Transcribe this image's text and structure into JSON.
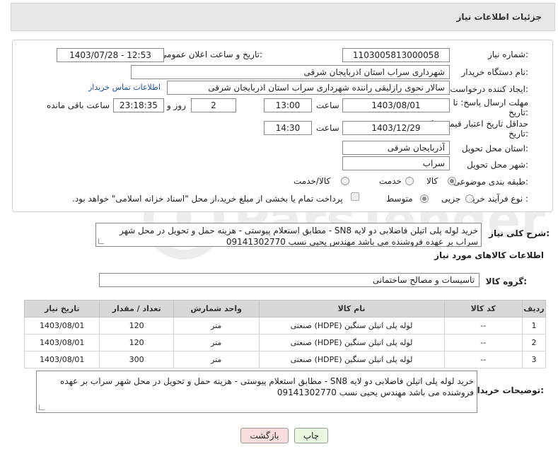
{
  "header": {
    "title": "جزئیات اطلاعات نیاز"
  },
  "fields": {
    "need_number_label": "شماره نیاز:",
    "need_number": "1103005813000058",
    "announce_label": "تاریخ و ساعت اعلان عمومی:",
    "announce_value": "1403/07/28 - 12:53",
    "buyer_org_label": "نام دستگاه خریدار:",
    "buyer_org": "شهرداری سراب استان اذربایجان شرقی",
    "requester_label": "ایجاد کننده درخواست:",
    "requester": "سالار نحوی رازلیقی راننده شهرداری سراب استان اذربایجان شرقی",
    "contact_link": "اطلاعات تماس خریدار",
    "deadline_label": "مهلت ارسال پاسخ: تا",
    "deadline_label2": "تاریخ:",
    "deadline_date": "1403/08/01",
    "time_label": "ساعت",
    "deadline_time": "13:00",
    "days_value": "2",
    "days_label": "روز و",
    "remaining_time": "23:18:35",
    "remaining_label": "ساعت باقی مانده",
    "validity_label": "حداقل تاریخ اعتبار قیمت: تا",
    "validity_label2": "تاریخ:",
    "validity_date": "1403/12/29",
    "validity_time": "14:30",
    "province_label": "استان محل تحویل:",
    "province": "آذربایجان شرقی",
    "city_label": "شهر محل تحویل:",
    "city": "سراب",
    "category_label": "طبقه بندی موضوعی:",
    "category_options": [
      "کالا",
      "خدمت",
      "کالا/خدمت"
    ],
    "process_label": "نوع فرآیند خرید :",
    "process_options": [
      "جزیی",
      "متوسط"
    ],
    "payment_note": "پرداخت تمام یا بخشی از مبلغ خرید،از محل \"اسناد خزانه اسلامی\" خواهد بود."
  },
  "summary": {
    "label": "شرح کلی نیاز:",
    "text": "خرید لوله پلی اتیلن فاضلابی دو لایه SN8 - مطابق استعلام پیوستی - هزینه حمل و تحویل در محل شهر سراب بر عهده فروشنده می باشد مهندس یحیی نسب 09141302770"
  },
  "goods": {
    "section_title": "اطلاعات کالاهای مورد نیاز",
    "group_label": "گروه کالا:",
    "group_value": "تاسیسات و مصالح ساختمانی",
    "columns": [
      "ردیف",
      "کد کالا",
      "نام کالا",
      "واحد شمارش",
      "تعداد / مقدار",
      "تاریخ نیاز"
    ],
    "rows": [
      [
        "1",
        "--",
        "لوله پلی اتیلن سنگین (HDPE) صنعتی",
        "متر",
        "120",
        "1403/08/01"
      ],
      [
        "2",
        "--",
        "لوله پلی اتیلن سنگین (HDPE) صنعتی",
        "متر",
        "120",
        "1403/08/01"
      ],
      [
        "3",
        "--",
        "لوله پلی اتیلن سنگین (HDPE) صنعتی",
        "متر",
        "300",
        "1403/08/01"
      ]
    ]
  },
  "buyer_notes": {
    "label": "توضیحات خریدار:",
    "text": "خرید لوله پلی اتیلن فاضلابی دو لایه SN8 - مطابق استعلام پیوستی - هزینه حمل و تحویل در محل شهر سراب بر عهده فروشنده می باشد مهندس یحیی نسب 09141302770"
  },
  "buttons": {
    "print": "چاپ",
    "back": "بازگشت"
  },
  "colors": {
    "print_bg": "#e9f7df",
    "back_bg": "#f9dede",
    "link": "#1a4fa0"
  }
}
